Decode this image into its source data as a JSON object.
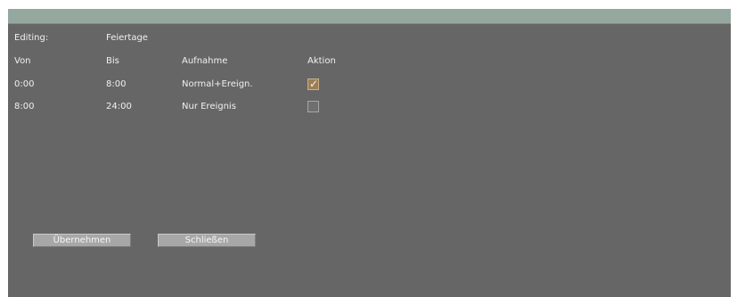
{
  "editing": {
    "label": "Editing:",
    "value": "Feiertage"
  },
  "table": {
    "headers": {
      "from": "Von",
      "to": "Bis",
      "recording": "Aufnahme",
      "action": "Aktion"
    },
    "rows": [
      {
        "from": "0:00",
        "to": "8:00",
        "recording": "Normal+Ereign.",
        "action_checked": true
      },
      {
        "from": "8:00",
        "to": "24:00",
        "recording": "Nur  Ereignis",
        "action_checked": false
      }
    ]
  },
  "buttons": {
    "apply": "Übernehmen",
    "close": "Schließen"
  },
  "icons": {
    "checkbox_checked": "checkbox-checked-icon",
    "checkbox_unchecked": "checkbox-unchecked-icon"
  },
  "colors": {
    "window_background": "#666666",
    "title_bar": "#95a89f",
    "button_face": "#a7a7a7",
    "checked_box": "#9d7f55"
  }
}
